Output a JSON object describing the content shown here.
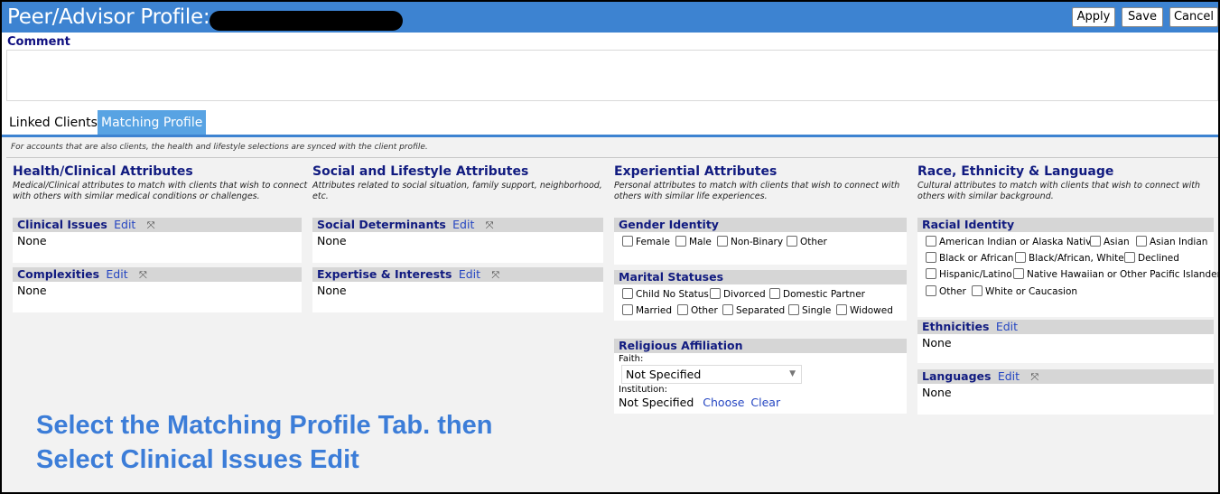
{
  "window": {
    "title": "Peer/Advisor Profile:"
  },
  "toolbar": {
    "apply_label": "Apply",
    "save_label": "Save",
    "cancel_label": "Cancel"
  },
  "comment": {
    "label": "Comment",
    "value": ""
  },
  "tabs": [
    {
      "label": "Linked Clients"
    },
    {
      "label": "Matching Profile"
    }
  ],
  "sync_note": "For accounts that are also clients, the health and lifestyle selections are synced with the client profile.",
  "columns": {
    "health": {
      "title": "Health/Clinical Attributes",
      "desc": "Medical/Clinical attributes to match with clients that wish to connect with others with similar medical conditions or challenges.",
      "clinical": {
        "label": "Clinical Issues",
        "edit": "Edit",
        "value": "None"
      },
      "complexities": {
        "label": "Complexities",
        "edit": "Edit",
        "value": "None"
      }
    },
    "social": {
      "title": "Social and Lifestyle Attributes",
      "desc": "Attributes related to social situation, family support, neighborhood, etc.",
      "determinants": {
        "label": "Social Determinants",
        "edit": "Edit",
        "value": "None"
      },
      "expertise": {
        "label": "Expertise & Interests",
        "edit": "Edit",
        "value": "None"
      }
    },
    "experiential": {
      "title": "Experiential Attributes",
      "desc": "Personal attributes to match with clients that wish to connect with others with similar life experiences.",
      "gender": {
        "label": "Gender Identity",
        "options": [
          "Female",
          "Male",
          "Non-Binary",
          "Other"
        ]
      },
      "marital": {
        "label": "Marital Statuses",
        "options": [
          "Child No Status",
          "Divorced",
          "Domestic Partner",
          "Married",
          "Other",
          "Separated",
          "Single",
          "Widowed"
        ]
      },
      "religion": {
        "label": "Religious Affiliation",
        "faith_label": "Faith:",
        "faith_value": "Not Specified",
        "institution_label": "Institution:",
        "institution_value": "Not Specified",
        "choose": "Choose",
        "clear": "Clear"
      }
    },
    "race": {
      "title": "Race, Ethnicity & Language",
      "desc": "Cultural attributes to match with clients that wish to connect with others with similar background.",
      "racial": {
        "label": "Racial Identity",
        "options": [
          "American Indian or Alaska Native",
          "Asian",
          "Asian Indian",
          "Black or African",
          "Black/African, White",
          "Declined",
          "Hispanic/Latino",
          "Native Hawaiian or Other Pacific Islander",
          "Other",
          "White or Caucasion"
        ]
      },
      "ethnicities": {
        "label": "Ethnicities",
        "edit": "Edit",
        "value": "None"
      },
      "languages": {
        "label": "Languages",
        "edit": "Edit",
        "value": "None"
      }
    }
  },
  "instruction": {
    "line1": "Select the Matching Profile Tab. then",
    "line2": "Select Clinical Issues Edit"
  },
  "colors": {
    "titlebar": "#3d83d1",
    "active_tab": "#58a3e3",
    "heading": "#111b80",
    "link": "#2546c2",
    "instruction": "#3c7dd8"
  },
  "icons": {
    "expand": "expand-arrows-icon",
    "dropdown": "chevron-down-icon"
  }
}
